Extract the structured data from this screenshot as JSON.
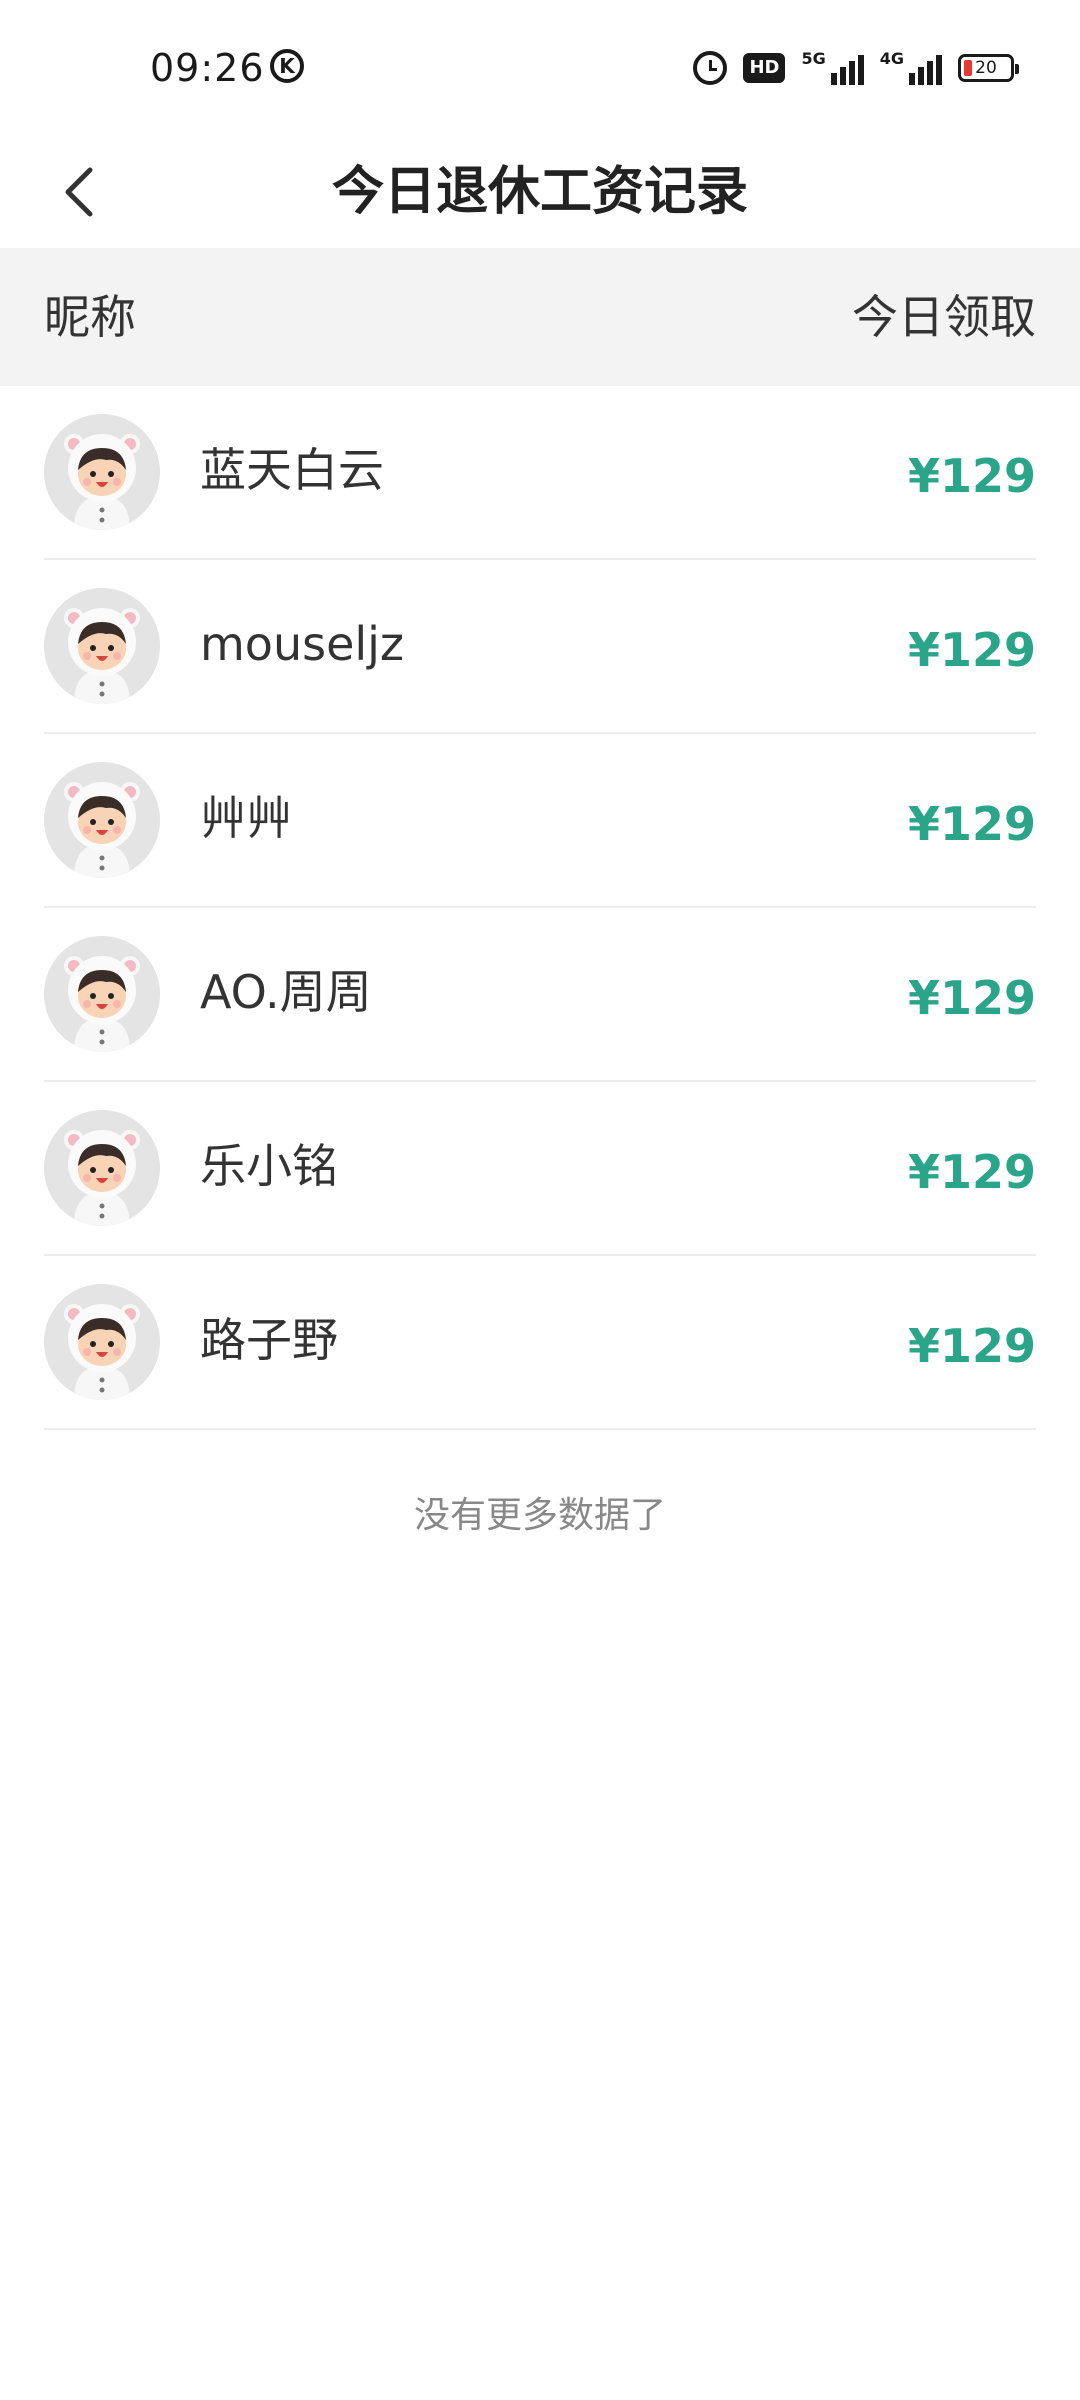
{
  "status_bar": {
    "time": "09:26",
    "k_icon_letter": "K",
    "hd_label": "HD",
    "network_1": "5G",
    "network_2": "4G",
    "battery_level": "20",
    "battery_color": "#e53935"
  },
  "nav": {
    "title": "今日退休工资记录",
    "back_icon": "chevron-left-icon"
  },
  "table_header": {
    "nickname_label": "昵称",
    "amount_label": "今日领取"
  },
  "records": [
    {
      "nickname": "蓝天白云",
      "amount": "¥129",
      "avatar_icon": "bear-hat-kid-avatar"
    },
    {
      "nickname": "mouseljz",
      "amount": "¥129",
      "avatar_icon": "bear-hat-kid-avatar"
    },
    {
      "nickname": "艸艸",
      "amount": "¥129",
      "avatar_icon": "bear-hat-kid-avatar"
    },
    {
      "nickname": "AO.周周",
      "amount": "¥129",
      "avatar_icon": "bear-hat-kid-avatar"
    },
    {
      "nickname": "乐小铭",
      "amount": "¥129",
      "avatar_icon": "bear-hat-kid-avatar"
    },
    {
      "nickname": "路子野",
      "amount": "¥129",
      "avatar_icon": "bear-hat-kid-avatar"
    }
  ],
  "footer": {
    "no_more": "没有更多数据了"
  },
  "colors": {
    "accent_amount": "#2aa58a",
    "header_bg": "#f3f3f3",
    "divider": "#ececec"
  }
}
